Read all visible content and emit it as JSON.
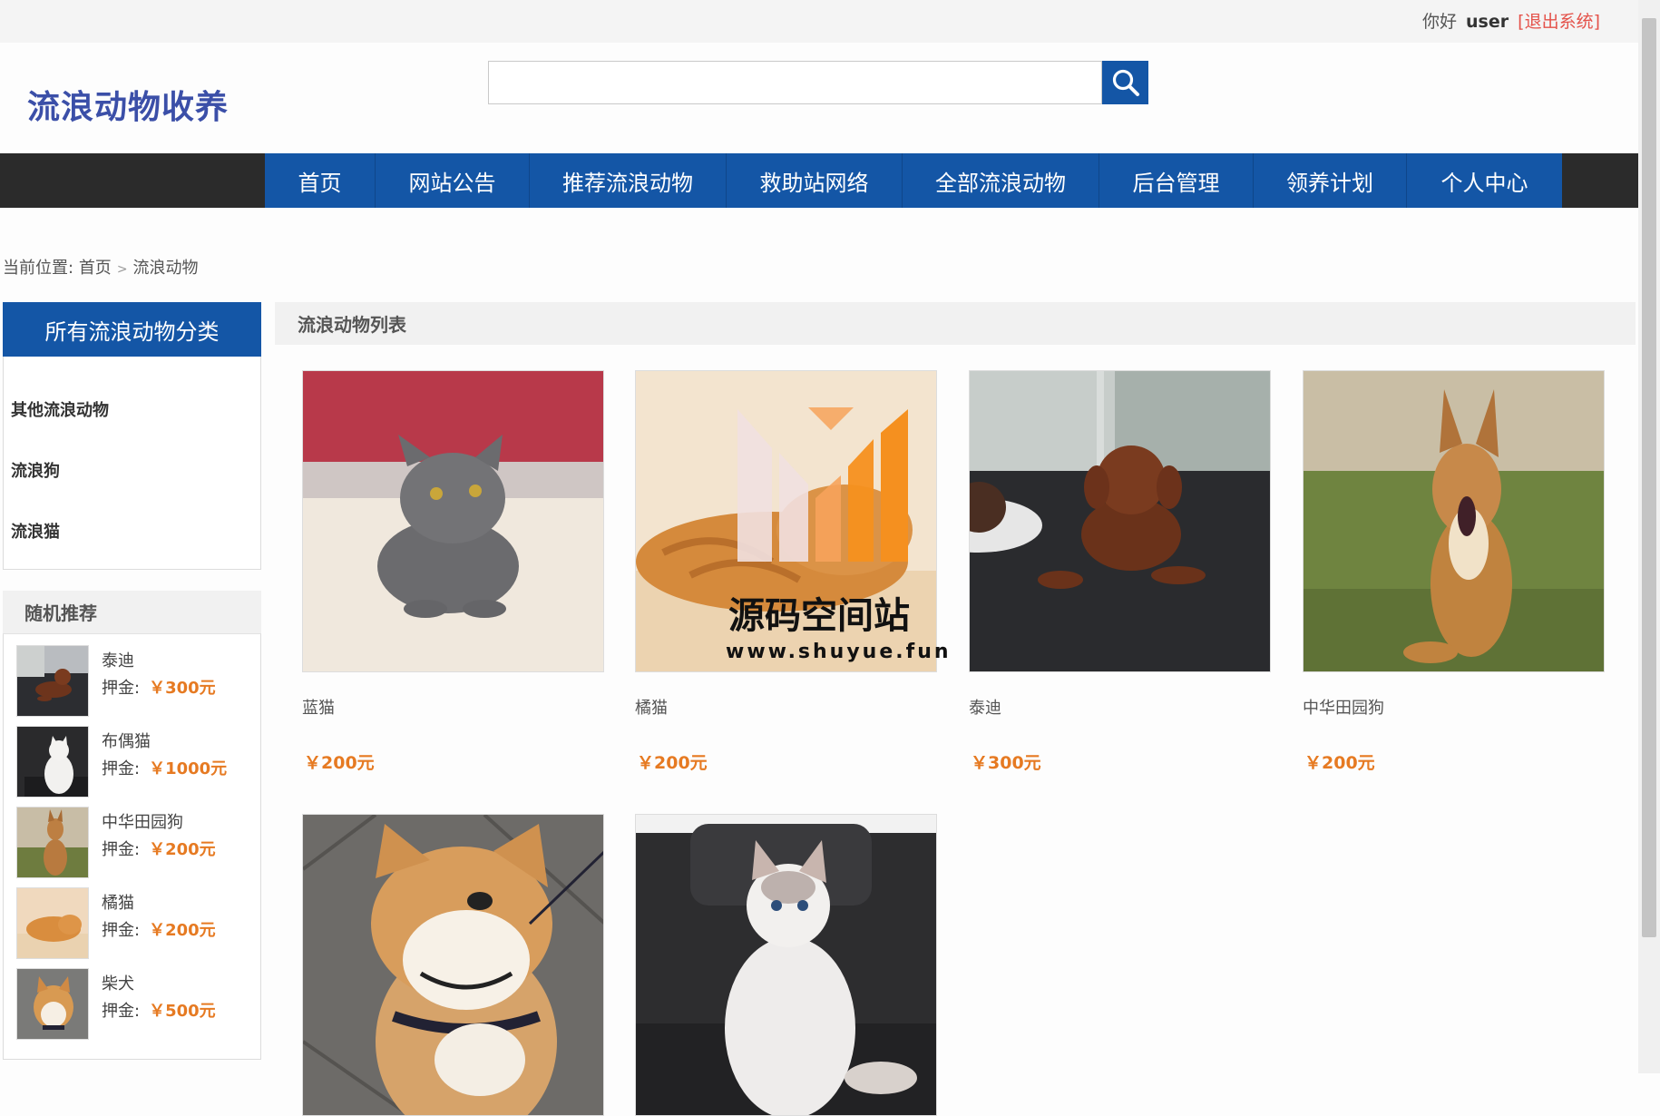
{
  "topbar": {
    "greeting": "你好",
    "user": "user",
    "logout": "[退出系统]"
  },
  "header": {
    "logo": "流浪动物收养",
    "search_placeholder": ""
  },
  "nav": [
    "首页",
    "网站公告",
    "推荐流浪动物",
    "救助站网络",
    "全部流浪动物",
    "后台管理",
    "领养计划",
    "个人中心"
  ],
  "breadcrumb": {
    "prefix": "当前位置:",
    "home": "首页",
    "current": "流浪动物"
  },
  "categories": {
    "title": "所有流浪动物分类",
    "items": [
      "其他流浪动物",
      "流浪狗",
      "流浪猫"
    ]
  },
  "recommend": {
    "title": "随机推荐",
    "deposit_label": "押金:",
    "items": [
      {
        "name": "泰迪",
        "price": "￥300元"
      },
      {
        "name": "布偶猫",
        "price": "￥1000元"
      },
      {
        "name": "中华田园狗",
        "price": "￥200元"
      },
      {
        "name": "橘猫",
        "price": "￥200元"
      },
      {
        "name": "柴犬",
        "price": "￥500元"
      }
    ]
  },
  "list": {
    "title": "流浪动物列表",
    "pets": [
      {
        "name": "蓝猫",
        "price": "￥200元"
      },
      {
        "name": "橘猫",
        "price": "￥200元"
      },
      {
        "name": "泰迪",
        "price": "￥300元"
      },
      {
        "name": "中华田园狗",
        "price": "￥200元"
      },
      {
        "name": "",
        "price": ""
      },
      {
        "name": "",
        "price": ""
      }
    ],
    "watermark_title": "源码空间站",
    "watermark_url": "www.shuyue.fun"
  },
  "colors": {
    "brand_blue": "#1456a6",
    "logo": "#3b4fa8",
    "price_orange": "#e67a22",
    "logout_red": "#e4524a",
    "nav_bg": "#2b2b2b"
  }
}
